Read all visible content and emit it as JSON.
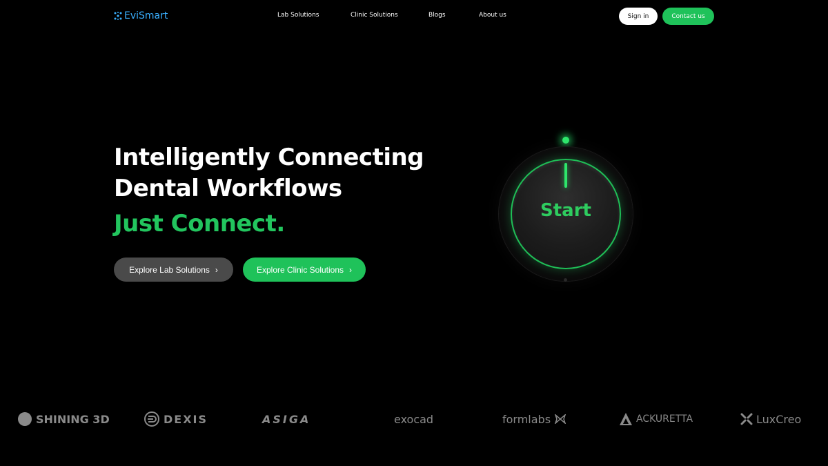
{
  "brand": {
    "name": "EviSmart",
    "icon": "snowflake-icon",
    "color": "#3ab0ff"
  },
  "nav": {
    "links": [
      "Lab Solutions",
      "Clinic Solutions",
      "Blogs",
      "About us"
    ],
    "signin_label": "Sign in",
    "contact_label": "Contact us"
  },
  "hero": {
    "title_line1": "Intelligently Connecting",
    "title_line2": "Dental Workflows",
    "tagline": "Just Connect.",
    "btn_lab": "Explore Lab Solutions",
    "btn_clinic": "Explore Clinic Solutions",
    "chevron": "›"
  },
  "knob": {
    "label": "Start"
  },
  "partners": [
    {
      "name": "SHINING 3D",
      "icon": "circle-logo-icon"
    },
    {
      "name": "DEXIS",
      "icon": "dexis-logo-icon"
    },
    {
      "name": "ASIGA",
      "icon": ""
    },
    {
      "name": "exocad",
      "icon": ""
    },
    {
      "name": "formlabs",
      "icon": "butterfly-icon"
    },
    {
      "name": "ACKURETTA",
      "icon": "triangle-logo-icon"
    },
    {
      "name": "LuxCreo",
      "icon": "x-logo-icon"
    }
  ],
  "colors": {
    "accent": "#1fc25a",
    "background": "#000000",
    "muted_logo": "#8a8a8a"
  }
}
